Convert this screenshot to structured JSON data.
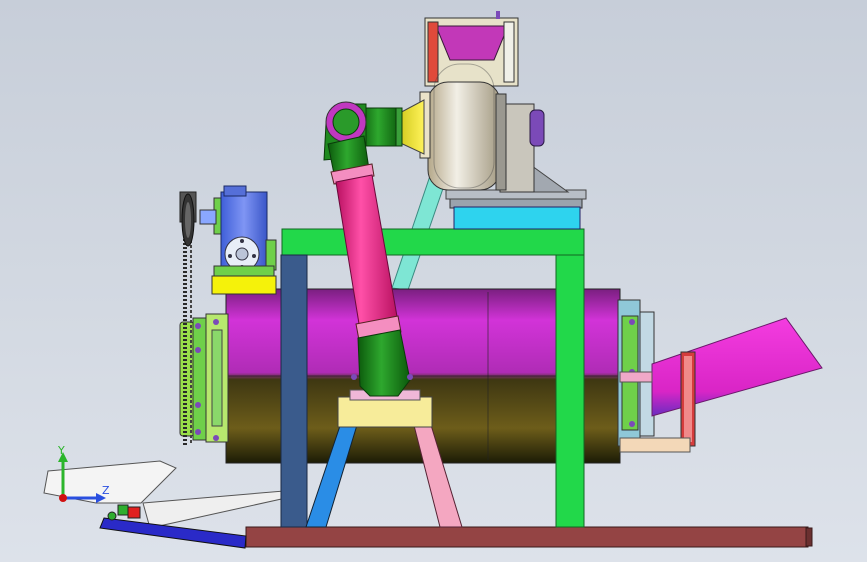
{
  "axes": {
    "y_label": "Y",
    "z_label": "Z",
    "colors": {
      "y": "#2bb52b",
      "z": "#2a4fe0",
      "origin": "#d01010"
    }
  },
  "colors": {
    "drum_top": "#d233d8",
    "drum_bottom": "#4a3d12",
    "frame_green": "#22d84a",
    "frame_post_dark": "#3a5b8c",
    "pipe_magenta": "#ff2f8c",
    "pipe_green": "#1c8a1c",
    "gearbox_blue": "#4f6fe8",
    "gearbox_yellow": "#f5f20a",
    "fan_hopper": "#c238b8",
    "fan_cone": "#f2ea10",
    "chute_magenta": "#ef2bd8",
    "base_plate": "#944444",
    "cyan_plate": "#2ed3ee",
    "leg_blue": "#2a8de6",
    "leg_pink": "#f4a7c1",
    "strut_cyan": "#7ee6d4"
  }
}
